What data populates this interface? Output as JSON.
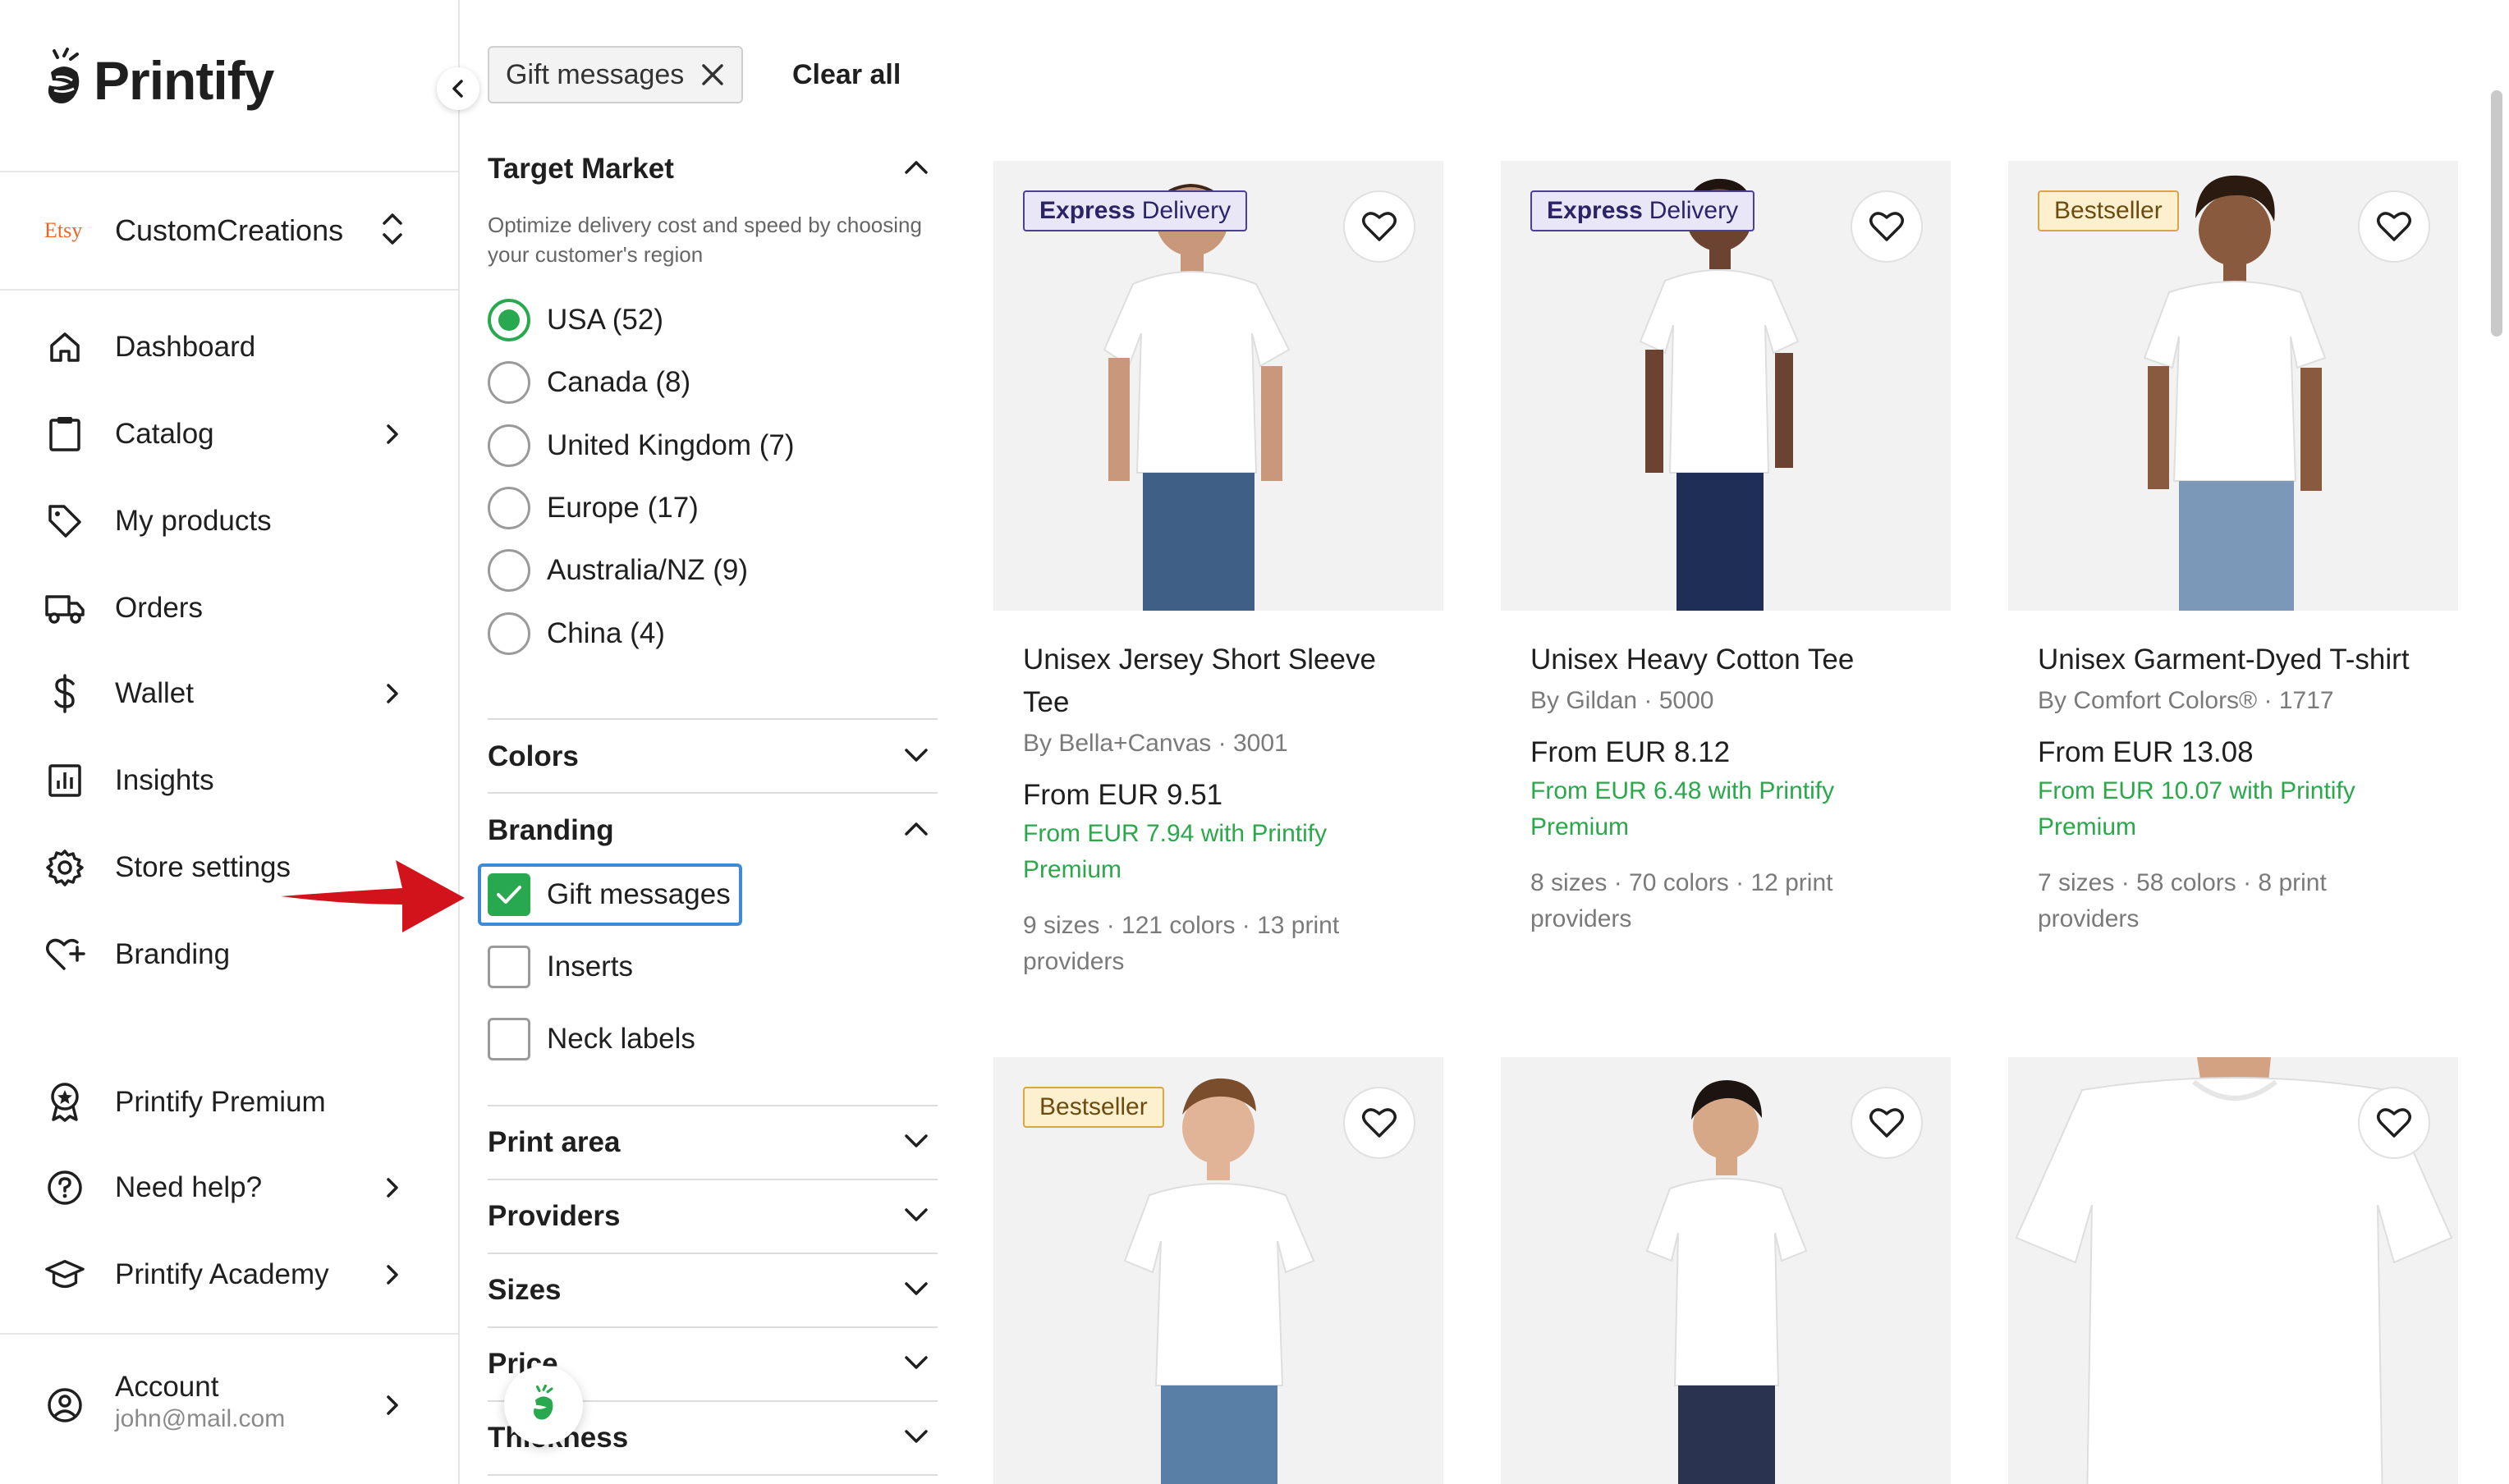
{
  "app": {
    "name": "Printify"
  },
  "store": {
    "platform": "Etsy",
    "name": "CustomCreations"
  },
  "nav": {
    "dashboard": "Dashboard",
    "catalog": "Catalog",
    "my_products": "My products",
    "orders": "Orders",
    "wallet": "Wallet",
    "insights": "Insights",
    "store_settings": "Store settings",
    "branding": "Branding",
    "premium": "Printify Premium",
    "help": "Need help?",
    "academy": "Printify Academy",
    "account": "Account",
    "account_email": "john@mail.com"
  },
  "filters": {
    "active_chip": "Gift messages",
    "clear_all": "Clear all",
    "target_market": {
      "title": "Target Market",
      "description": "Optimize delivery cost and speed by choosing your customer's region",
      "options": [
        "USA (52)",
        "Canada (8)",
        "United Kingdom (7)",
        "Europe (17)",
        "Australia/NZ (9)",
        "China (4)"
      ],
      "selected": "USA (52)"
    },
    "colors": "Colors",
    "branding": {
      "title": "Branding",
      "options": [
        "Gift messages",
        "Inserts",
        "Neck labels"
      ],
      "checked": [
        "Gift messages"
      ]
    },
    "print_area": "Print area",
    "providers": "Providers",
    "sizes": "Sizes",
    "price": "Price",
    "thickness": "Thickness"
  },
  "products": [
    {
      "badge_bold": "Express",
      "badge_rest": "Delivery",
      "title": "Unisex Jersey Short Sleeve Tee",
      "by": "By Bella+Canvas · 3001",
      "price": "From EUR 9.51",
      "premium": "From EUR 7.94 with Printify Premium",
      "meta": "9 sizes · 121 colors · 13 print providers"
    },
    {
      "badge_bold": "Express",
      "badge_rest": "Delivery",
      "title": "Unisex Heavy Cotton Tee",
      "by": "By Gildan · 5000",
      "price": "From EUR 8.12",
      "premium": "From EUR 6.48 with Printify Premium",
      "meta": "8 sizes · 70 colors · 12 print providers"
    },
    {
      "badge": "Bestseller",
      "title": "Unisex Garment-Dyed T-shirt",
      "by": "By Comfort Colors® · 1717",
      "price": "From EUR 13.08",
      "premium": "From EUR 10.07 with Printify Premium",
      "meta": "7 sizes · 58 colors · 8 print providers"
    },
    {
      "badge": "Bestseller"
    },
    {},
    {}
  ],
  "colors": {
    "accent_green": "#29a94f",
    "highlight_blue": "#3c8ad8",
    "arrow_red": "#d3131b",
    "etsy_orange": "#f1641e"
  }
}
